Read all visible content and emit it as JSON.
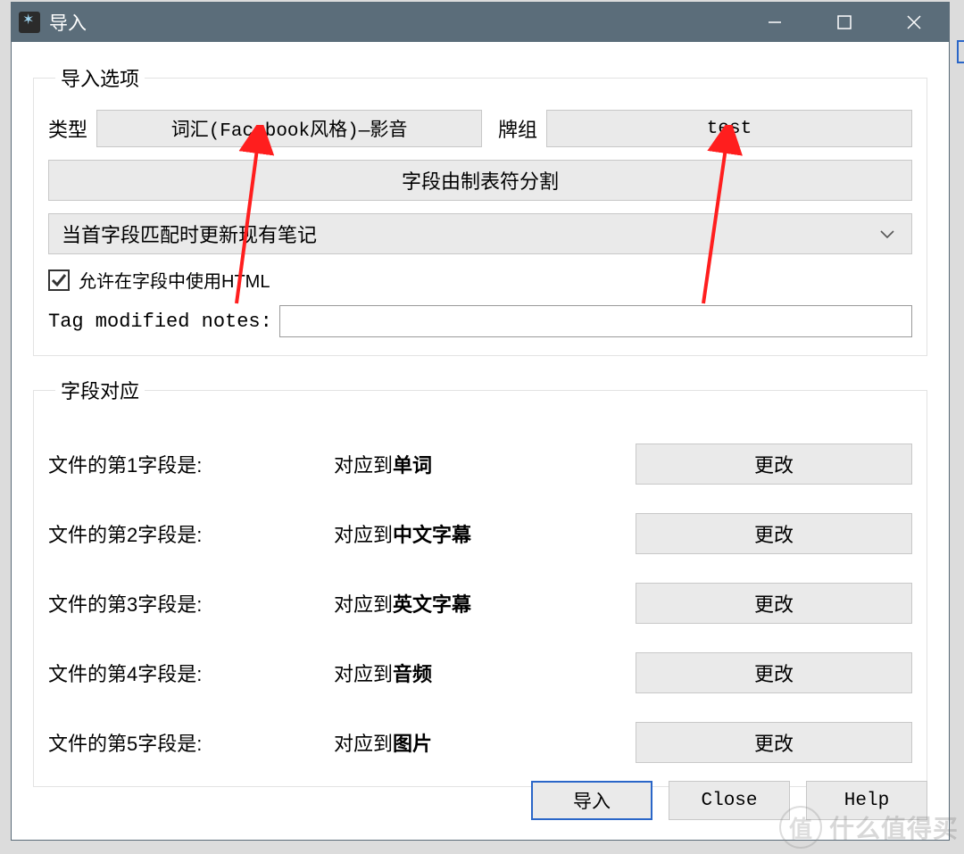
{
  "window": {
    "title": "导入"
  },
  "importOptions": {
    "legend": "导入选项",
    "typeLabel": "类型",
    "typeValue": "词汇(Facebook风格)—影音",
    "deckLabel": "牌组",
    "deckValue": "test",
    "separatorButton": "字段由制表符分割",
    "updateBehavior": "当首字段匹配时更新现有笔记",
    "allowHtmlLabel": "允许在字段中使用HTML",
    "allowHtmlChecked": true,
    "tagModifiedLabel": "Tag modified notes:",
    "tagModifiedValue": ""
  },
  "fieldMapping": {
    "legend": "字段对应",
    "prefix": "对应到",
    "changeLabel": "更改",
    "rows": [
      {
        "label": "文件的第1字段是:",
        "target": "单词"
      },
      {
        "label": "文件的第2字段是:",
        "target": "中文字幕"
      },
      {
        "label": "文件的第3字段是:",
        "target": "英文字幕"
      },
      {
        "label": "文件的第4字段是:",
        "target": "音频"
      },
      {
        "label": "文件的第5字段是:",
        "target": "图片"
      }
    ]
  },
  "buttons": {
    "import": "导入",
    "close": "Close",
    "help": "Help"
  },
  "watermark": {
    "logo": "值",
    "text": "什么值得买"
  }
}
